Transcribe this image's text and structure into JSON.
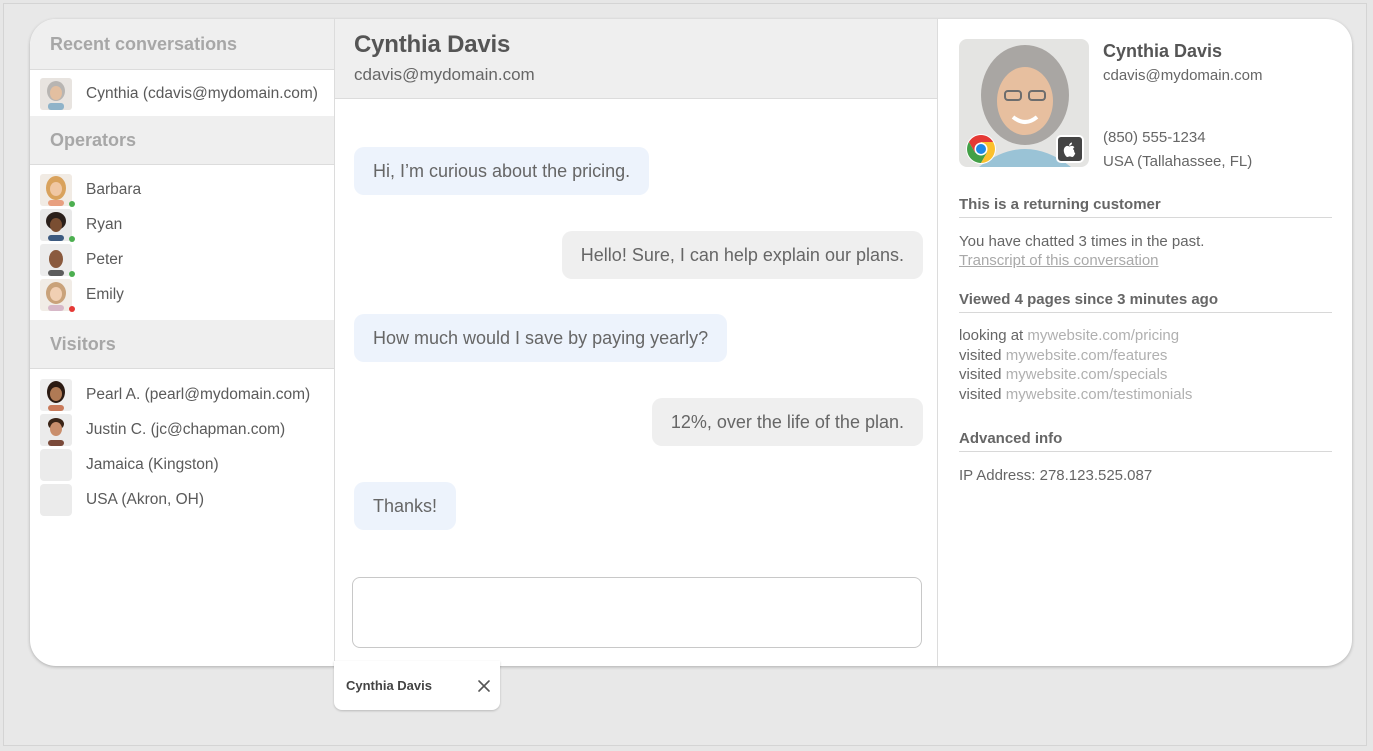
{
  "sidebar": {
    "recent_title": "Recent conversations",
    "recent": [
      {
        "label": "Cynthia (cdavis@mydomain.com)"
      }
    ],
    "operators_title": "Operators",
    "operators": [
      {
        "label": "Barbara",
        "status_color": "#4caf50"
      },
      {
        "label": "Ryan",
        "status_color": "#4caf50"
      },
      {
        "label": "Peter",
        "status_color": "#4caf50"
      },
      {
        "label": "Emily",
        "status_color": "#e53935"
      }
    ],
    "visitors_title": "Visitors",
    "visitors": [
      {
        "label": "Pearl A. (pearl@mydomain.com)"
      },
      {
        "label": "Justin C. (jc@chapman.com)"
      },
      {
        "label": "Jamaica (Kingston)"
      },
      {
        "label": "USA (Akron, OH)"
      }
    ]
  },
  "chat": {
    "name": "Cynthia Davis",
    "email": "cdavis@mydomain.com",
    "messages": [
      {
        "from": "visitor",
        "text": "Hi, I’m curious about the pricing."
      },
      {
        "from": "operator",
        "text": "Hello! Sure, I can help explain our plans."
      },
      {
        "from": "visitor",
        "text": "How much would I save by paying yearly?"
      },
      {
        "from": "operator",
        "text": "12%, over the life of the plan."
      },
      {
        "from": "visitor",
        "text": "Thanks!"
      }
    ],
    "composer_placeholder": ""
  },
  "profile": {
    "name": "Cynthia Davis",
    "email": "cdavis@mydomain.com",
    "phone": "(850) 555-1234",
    "location": "USA (Tallahassee, FL)",
    "browser_icon": "chrome-icon",
    "os_icon": "apple-icon",
    "returning_title": "This is a returning customer",
    "returning_text": "You have chatted 3 times in the past.",
    "transcript_link": "Transcript of this conversation",
    "pages_title": "Viewed 4 pages since 3 minutes ago",
    "pages": [
      {
        "action": "looking at",
        "url": "mywebsite.com/pricing"
      },
      {
        "action": "visited",
        "url": "mywebsite.com/features"
      },
      {
        "action": "visited",
        "url": "mywebsite.com/specials"
      },
      {
        "action": "visited",
        "url": "mywebsite.com/testimonials"
      }
    ],
    "advanced_title": "Advanced info",
    "ip_text": "IP Address: 278.123.525.087"
  },
  "tab": {
    "label": "Cynthia Davis"
  },
  "colors": {
    "visitor_bubble": "#edf3fc",
    "operator_bubble": "#efefef",
    "header_bg": "#efefef",
    "online": "#4caf50",
    "away": "#e53935"
  }
}
